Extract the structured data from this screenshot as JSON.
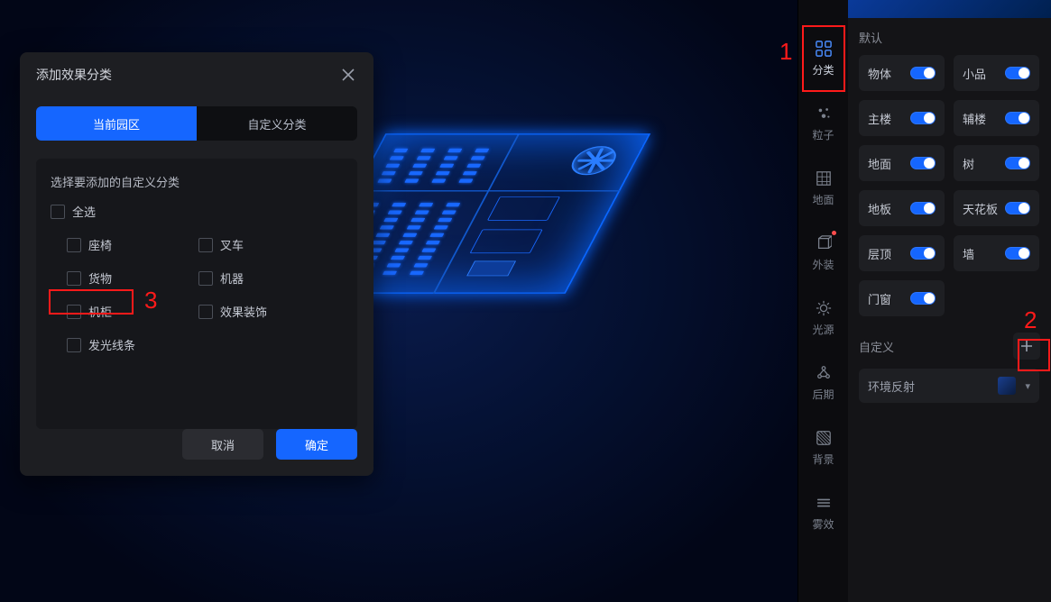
{
  "modal": {
    "title": "添加效果分类",
    "tabs": {
      "current": "当前园区",
      "custom": "自定义分类"
    },
    "list_title": "选择要添加的自定义分类",
    "select_all": "全选",
    "items_left": [
      "座椅",
      "货物",
      "机柜",
      "发光线条"
    ],
    "items_right": [
      "叉车",
      "机器",
      "效果装饰"
    ],
    "cancel": "取消",
    "confirm": "确定"
  },
  "side_icons": {
    "category": "分类",
    "particle": "粒子",
    "ground": "地面",
    "exterior": "外装",
    "light": "光源",
    "post": "后期",
    "background": "背景",
    "fog": "雾效"
  },
  "panel": {
    "section_default": "默认",
    "section_custom": "自定义",
    "toggles": {
      "object": "物体",
      "ornament": "小品",
      "main_building": "主楼",
      "aux_building": "辅楼",
      "ground": "地面",
      "tree": "树",
      "floor": "地板",
      "ceiling": "天花板",
      "roof": "层顶",
      "wall": "墙",
      "window": "门窗"
    },
    "env_reflect": "环境反射"
  },
  "annotations": {
    "n1": "1",
    "n2": "2",
    "n3": "3"
  }
}
